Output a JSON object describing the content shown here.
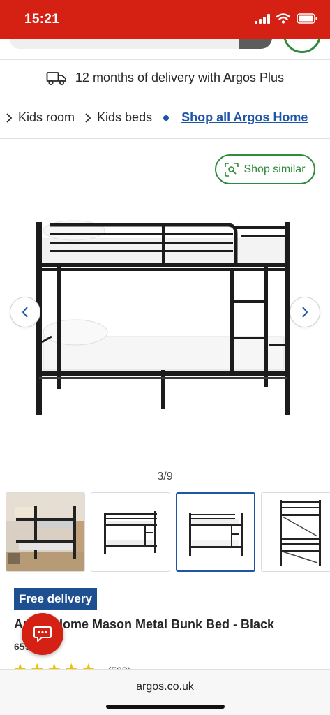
{
  "status_bar": {
    "time": "15:21",
    "color": "#d42114"
  },
  "delivery_banner": {
    "icon": "truck-icon",
    "text": "12 months of delivery with Argos Plus"
  },
  "breadcrumb": {
    "items": [
      {
        "label": "Kids room"
      },
      {
        "label": "Kids beds"
      }
    ],
    "link": "Shop all Argos Home"
  },
  "gallery": {
    "shop_similar": "Shop similar",
    "counter": "3/9",
    "current_index": 3,
    "total_images": 9,
    "thumbnails": [
      {
        "name": "room-photo"
      },
      {
        "name": "bunk-bed-angle"
      },
      {
        "name": "bunk-bed-front"
      },
      {
        "name": "bunk-bed-side"
      }
    ]
  },
  "product": {
    "badge": "Free delivery",
    "title": "Argos Home Mason Metal Bunk Bed - Black",
    "code": "659/3722",
    "rating": 5,
    "review_count": "(528)"
  },
  "browser": {
    "url": "argos.co.uk"
  },
  "colors": {
    "brand_red": "#d42114",
    "link_blue": "#1d56a7",
    "accent_green": "#2f8a3b",
    "badge_blue": "#1d4f91",
    "star": "#f2c200"
  }
}
